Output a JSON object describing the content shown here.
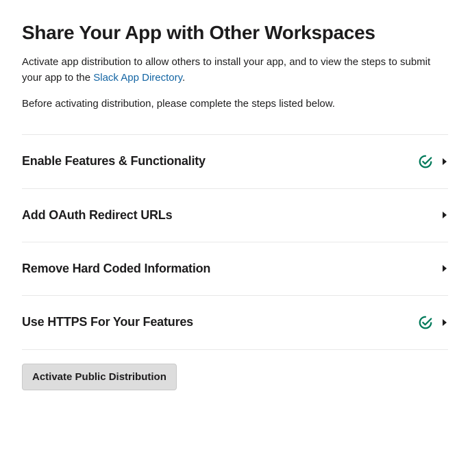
{
  "header": {
    "title": "Share Your App with Other Workspaces",
    "intro_before_link": "Activate app distribution to allow others to install your app, and to view the steps to submit your app to the ",
    "intro_link_text": "Slack App Directory",
    "intro_after_link": ".",
    "before_activation": "Before activating distribution, please complete the steps listed below."
  },
  "steps": [
    {
      "label": "Enable Features & Functionality",
      "completed": true
    },
    {
      "label": "Add OAuth Redirect URLs",
      "completed": false
    },
    {
      "label": "Remove Hard Coded Information",
      "completed": false
    },
    {
      "label": "Use HTTPS For Your Features",
      "completed": true
    }
  ],
  "activate_button_label": "Activate Public Distribution",
  "colors": {
    "check_green": "#007a5a",
    "link_blue": "#1264a3"
  }
}
